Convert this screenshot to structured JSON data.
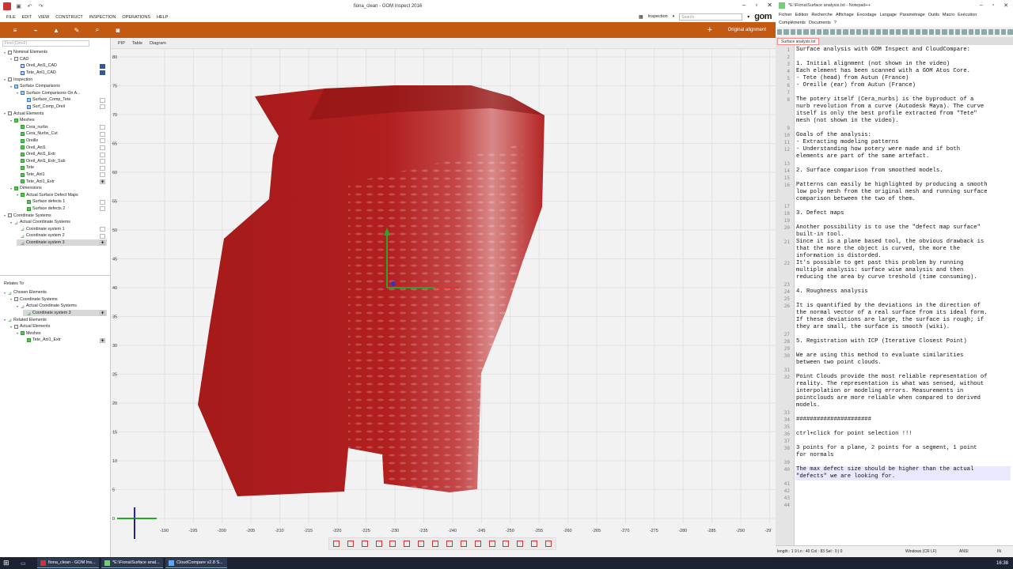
{
  "gom": {
    "title": "fiona_clean - GOM Inspect 2016",
    "menu": [
      "FILE",
      "EDIT",
      "VIEW",
      "CONSTRUCT",
      "INSPECTION",
      "OPERATIONS",
      "HELP"
    ],
    "workspace": "Inspection",
    "search_placeholder": "Search",
    "logo": "gom",
    "alignment": "Original alignment",
    "find_placeholder": "Find (Ctrl+F)",
    "tree": [
      {
        "indent": 0,
        "tg": "▾",
        "icon": "folder",
        "label": "Nominal Elements"
      },
      {
        "indent": 1,
        "tg": "▾",
        "icon": "folder",
        "label": "CAD"
      },
      {
        "indent": 2,
        "tg": "",
        "icon": "cad",
        "label": "Oreil_Anl1_CAD",
        "check": "on"
      },
      {
        "indent": 2,
        "tg": "",
        "icon": "cad",
        "label": "Tete_Anl1_CAD",
        "check": "on"
      },
      {
        "indent": 0,
        "tg": "▾",
        "icon": "folder",
        "label": "Inspection"
      },
      {
        "indent": 1,
        "tg": "▾",
        "icon": "cmp",
        "label": "Surface Comparisons"
      },
      {
        "indent": 2,
        "tg": "▾",
        "icon": "cmp",
        "label": "Surface Comparisons On A..."
      },
      {
        "indent": 3,
        "tg": "",
        "icon": "cmp",
        "label": "Surface_Comp_Tete",
        "check": "off"
      },
      {
        "indent": 3,
        "tg": "",
        "icon": "cmp",
        "label": "Surf_Comp_Oreil",
        "check": "off"
      },
      {
        "indent": 0,
        "tg": "▾",
        "icon": "folder",
        "label": "Actual Elements"
      },
      {
        "indent": 1,
        "tg": "▾",
        "icon": "mesh",
        "label": "Meshes"
      },
      {
        "indent": 2,
        "tg": "",
        "icon": "mesh",
        "label": "Cera_nurbs",
        "check": "off"
      },
      {
        "indent": 2,
        "tg": "",
        "icon": "mesh",
        "label": "Cera_Nurbs_Cut",
        "check": "off"
      },
      {
        "indent": 2,
        "tg": "",
        "icon": "mesh",
        "label": "Oreille",
        "check": "off"
      },
      {
        "indent": 2,
        "tg": "",
        "icon": "mesh",
        "label": "Oreil_Anl1",
        "check": "off"
      },
      {
        "indent": 2,
        "tg": "",
        "icon": "mesh",
        "label": "Oreil_Anl1_Extr",
        "check": "off"
      },
      {
        "indent": 2,
        "tg": "",
        "icon": "mesh",
        "label": "Oreil_Anl1_Extr_Sub",
        "check": "off"
      },
      {
        "indent": 2,
        "tg": "",
        "icon": "mesh",
        "label": "Tete",
        "check": "off"
      },
      {
        "indent": 2,
        "tg": "",
        "icon": "mesh",
        "label": "Tete_Anl1",
        "check": "off"
      },
      {
        "indent": 2,
        "tg": "",
        "icon": "mesh",
        "label": "Tete_Anl1_Extr",
        "check": "eye"
      },
      {
        "indent": 1,
        "tg": "▾",
        "icon": "mesh",
        "label": "Dimensions"
      },
      {
        "indent": 2,
        "tg": "▾",
        "icon": "mesh",
        "label": "Actual Surface Defect Maps"
      },
      {
        "indent": 3,
        "tg": "",
        "icon": "mesh",
        "label": "Surface defects 1",
        "check": "off"
      },
      {
        "indent": 3,
        "tg": "",
        "icon": "mesh",
        "label": "Surface defects 2",
        "check": "off"
      },
      {
        "indent": 0,
        "tg": "▾",
        "icon": "folder",
        "label": "Coordinate Systems"
      },
      {
        "indent": 1,
        "tg": "▾",
        "icon": "cs",
        "label": "Actual Coordinate Systems"
      },
      {
        "indent": 2,
        "tg": "",
        "icon": "cs",
        "label": "Coordinate system 1",
        "check": "off"
      },
      {
        "indent": 2,
        "tg": "",
        "icon": "cs",
        "label": "Coordinate system 2",
        "check": "off"
      },
      {
        "indent": 2,
        "tg": "",
        "icon": "cs",
        "label": "Coordinate system 3",
        "check": "eye",
        "sel": true
      }
    ],
    "relates_to": "Relates To",
    "tree2": [
      {
        "indent": 0,
        "tg": "▾",
        "icon": "cs",
        "label": "Chosen Elements"
      },
      {
        "indent": 1,
        "tg": "▾",
        "icon": "folder",
        "label": "Coordinate Systems"
      },
      {
        "indent": 2,
        "tg": "▾",
        "icon": "cs",
        "label": "Actual Coordinate Systems"
      },
      {
        "indent": 3,
        "tg": "",
        "icon": "cs",
        "label": "Coordinate system 3",
        "check": "eye",
        "sel": true
      },
      {
        "indent": 0,
        "tg": "▾",
        "icon": "cs",
        "label": "Related Elements"
      },
      {
        "indent": 1,
        "tg": "▾",
        "icon": "folder",
        "label": "Actual Elements"
      },
      {
        "indent": 2,
        "tg": "▾",
        "icon": "mesh",
        "label": "Meshes"
      },
      {
        "indent": 3,
        "tg": "",
        "icon": "mesh",
        "label": "Tete_Anl1_Extr",
        "check": "eye"
      }
    ],
    "view_tabs": [
      "PIP",
      "Table",
      "Diagram"
    ],
    "y_ticks": [
      "80",
      "75",
      "70",
      "65",
      "60",
      "55",
      "50",
      "45",
      "40",
      "35",
      "30",
      "25",
      "20",
      "15",
      "10",
      "5",
      "0"
    ],
    "x_ticks": [
      "-190",
      "-195",
      "-200",
      "-205",
      "-210",
      "-215",
      "-220",
      "-225",
      "-230",
      "-235",
      "-240",
      "-245",
      "-250",
      "-255",
      "-260",
      "-265",
      "-270",
      "-275",
      "-280",
      "-285",
      "-290",
      "-29"
    ]
  },
  "notepad": {
    "title": "*E:\\Fiona\\Surface analysis.txt - Notepad++",
    "menu1": [
      "Fichier",
      "Edition",
      "Recherche",
      "Affichage",
      "Encodage",
      "Langage",
      "Paramétrage",
      "Outils",
      "Macro",
      "Exécution"
    ],
    "menu2": [
      "Compléments",
      "Documents",
      "?"
    ],
    "tab": "Surface analysis.txt",
    "lines": [
      {
        "n": "1",
        "t": "Surface analysis with GOM Inspect and CloudCompare:"
      },
      {
        "n": "2",
        "t": ""
      },
      {
        "n": "3",
        "t": "1. Initial alignment (not shown in the video)"
      },
      {
        "n": "4",
        "t": "Each element has been scanned with a GOM Atos Core."
      },
      {
        "n": "5",
        "t": "- Tete (head) from Autun (France)"
      },
      {
        "n": "6",
        "t": "- Oreille (ear) from Autun (France)"
      },
      {
        "n": "7",
        "t": ""
      },
      {
        "n": "8",
        "t": "The potery itself (Cera_nurbs) is the byproduct of a\nnurb revolution from a curve (Autodesk Maya). The curve\nitself is only the best profile extracted from \"Tete\"\nmesh (not shown in the video)."
      },
      {
        "n": "9",
        "t": ""
      },
      {
        "n": "10",
        "t": "Goals of the analysis:"
      },
      {
        "n": "11",
        "t": "- Extracting modeling patterns"
      },
      {
        "n": "12",
        "t": "- Understanding how potery were made and if both\nelements are part of the same artefact."
      },
      {
        "n": "13",
        "t": ""
      },
      {
        "n": "14",
        "t": "2. Surface comparison from smoothed models."
      },
      {
        "n": "15",
        "t": ""
      },
      {
        "n": "16",
        "t": "Patterns can easily be highlighted by producing a smooth\nlow poly mesh from the original mesh and running surface\ncomparison between the two of them."
      },
      {
        "n": "17",
        "t": ""
      },
      {
        "n": "18",
        "t": "3. Defect maps"
      },
      {
        "n": "19",
        "t": ""
      },
      {
        "n": "20",
        "t": "Another possibility is to use the \"defect map surface\"\nbuilt-in tool."
      },
      {
        "n": "21",
        "t": "Since it is a plane based tool, the obvious drawback is\nthat the more the object is curved, the more the\ninformation is distorded."
      },
      {
        "n": "22",
        "t": "It's possible to get past this problem by running\nmultiple analysis: surface wise analysis and then\nreducing the area by curve treshold (time consuming)."
      },
      {
        "n": "23",
        "t": ""
      },
      {
        "n": "24",
        "t": "4. Roughness analysis"
      },
      {
        "n": "25",
        "t": ""
      },
      {
        "n": "26",
        "t": "It is quantified by the deviations in the direction of\nthe normal vector of a real surface from its ideal form.\nIf these deviations are large, the surface is rough; if\nthey are small, the surface is smooth (wiki)."
      },
      {
        "n": "27",
        "t": ""
      },
      {
        "n": "28",
        "t": "5. Registration with ICP (Iterative Closest Point)"
      },
      {
        "n": "29",
        "t": ""
      },
      {
        "n": "30",
        "t": "We are using this method to evaluate similarities\nbetween two point clouds."
      },
      {
        "n": "31",
        "t": ""
      },
      {
        "n": "32",
        "t": "Point Clouds provide the most reliable representation of\nreality. The representation is what was sensed, without\ninterpolation or modeling errors. Measurements in\npointclouds are more reliable when compared to derived\nmodels."
      },
      {
        "n": "33",
        "t": ""
      },
      {
        "n": "34",
        "t": "######################"
      },
      {
        "n": "35",
        "t": ""
      },
      {
        "n": "36",
        "t": "ctrl+click for point selection !!!"
      },
      {
        "n": "37",
        "t": ""
      },
      {
        "n": "38",
        "t": "3 points for a plane, 2 points for a segment, 1 point\nfor normals"
      },
      {
        "n": "39",
        "t": ""
      },
      {
        "n": "40",
        "t": "The max defect size should be higher than the actual\n\"defects\" we are looking for."
      },
      {
        "n": "41",
        "t": ""
      },
      {
        "n": "42",
        "t": ""
      },
      {
        "n": "43",
        "t": ""
      },
      {
        "n": "44",
        "t": ""
      }
    ],
    "status": {
      "pos": "length : 1 9 Ln : 40   Col : 83   Sel : 0 | 0",
      "eol": "Windows (CR LF)",
      "enc": "ANSI",
      "ins": "IN"
    }
  },
  "taskbar": {
    "items": [
      "fiona_clean - GOM Ins...",
      "*E:\\Fiona\\Surface anal...",
      "CloudCompare v2.8 S..."
    ],
    "clock": "16:38"
  }
}
